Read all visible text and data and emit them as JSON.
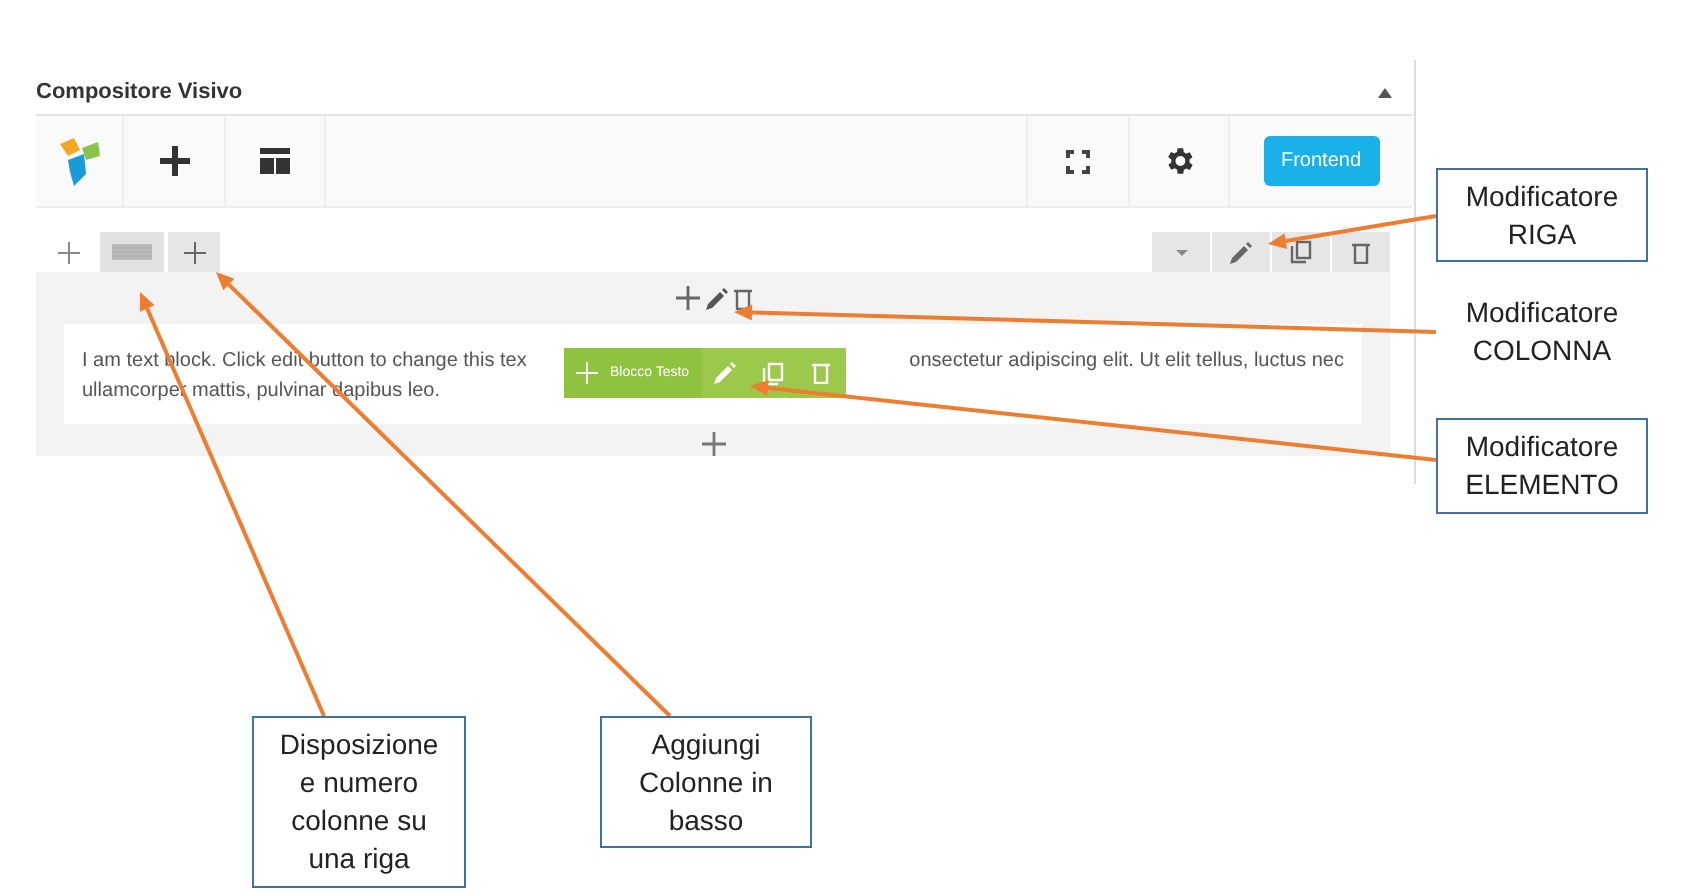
{
  "panel": {
    "title": "Compositore Visivo",
    "frontend_button": "Frontend"
  },
  "text_block": {
    "line_1_start": "I am text block. Click edit button to change this tex",
    "line_1_end": "onsectetur adipiscing elit. Ut elit tellus, luctus nec",
    "line_2": "ullamcorper mattis, pulvinar dapibus leo."
  },
  "element_toolbar": {
    "label": "Blocco Testo"
  },
  "annotations": [
    {
      "text": "Modificatore\nRIGA",
      "boxed": true
    },
    {
      "text": "Modificatore\nCOLONNA",
      "boxed": false
    },
    {
      "text": "Modificatore\nELEMENTO",
      "boxed": true
    },
    {
      "text": "Disposizione\ne numero\ncolonne su\nuna riga",
      "boxed": true
    },
    {
      "text": "Aggiungi\nColonne in\nbasso",
      "boxed": true
    }
  ]
}
